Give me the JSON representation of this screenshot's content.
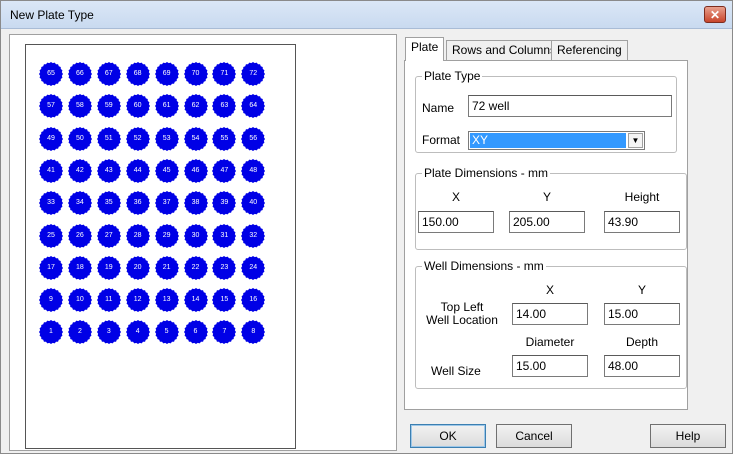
{
  "window": {
    "title": "New Plate Type",
    "close_label": "✕"
  },
  "plate": {
    "well_color": "#0000e6",
    "rows": [
      [
        65,
        66,
        67,
        68,
        69,
        70,
        71,
        72
      ],
      [
        57,
        58,
        59,
        60,
        61,
        62,
        63,
        64
      ],
      [
        49,
        50,
        51,
        52,
        53,
        54,
        55,
        56
      ],
      [
        41,
        42,
        43,
        44,
        45,
        46,
        47,
        48
      ],
      [
        33,
        34,
        35,
        36,
        37,
        38,
        39,
        40
      ],
      [
        25,
        26,
        27,
        28,
        29,
        30,
        31,
        32
      ],
      [
        17,
        18,
        19,
        20,
        21,
        22,
        23,
        24
      ],
      [
        9,
        10,
        11,
        12,
        13,
        14,
        15,
        16
      ],
      [
        1,
        2,
        3,
        4,
        5,
        6,
        7,
        8
      ]
    ]
  },
  "tabs": {
    "plate": "Plate",
    "rows_columns": "Rows and Columns",
    "referencing": "Referencing"
  },
  "plate_type": {
    "legend": "Plate Type",
    "name_label": "Name",
    "name_value": "72 well",
    "format_label": "Format",
    "format_value": "XY"
  },
  "plate_dimensions": {
    "legend": "Plate Dimensions - mm",
    "x_label": "X",
    "y_label": "Y",
    "height_label": "Height",
    "x_value": "150.00",
    "y_value": "205.00",
    "height_value": "43.90"
  },
  "well_dimensions": {
    "legend": "Well Dimensions - mm",
    "x_label": "X",
    "y_label": "Y",
    "top_left_label_1": "Top Left",
    "top_left_label_2": "Well Location",
    "x_value": "14.00",
    "y_value": "15.00",
    "diameter_label": "Diameter",
    "depth_label": "Depth",
    "well_size_label": "Well Size",
    "diameter_value": "15.00",
    "depth_value": "48.00"
  },
  "buttons": {
    "ok": "OK",
    "cancel": "Cancel",
    "help": "Help"
  }
}
